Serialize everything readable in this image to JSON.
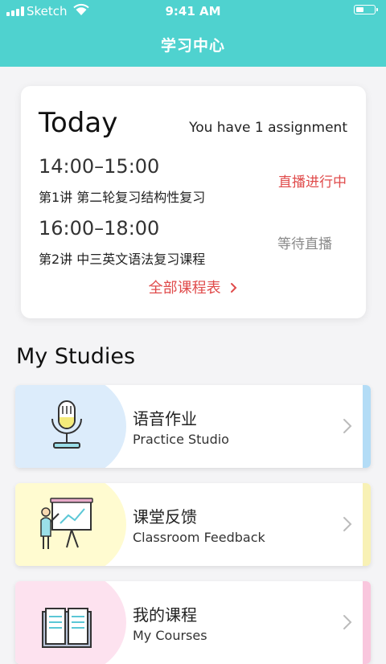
{
  "status_bar": {
    "carrier": "Sketch",
    "time": "9:41 AM",
    "battery_level": 0.45
  },
  "header": {
    "title": "学习中心"
  },
  "today": {
    "title": "Today",
    "assignment_text": "You have 1 assignment",
    "sessions": [
      {
        "time": "14:00–15:00",
        "title": "第1讲 第二轮复习结构性复习",
        "status": "直播进行中",
        "status_color": "#e04b4b"
      },
      {
        "time": "16:00–18:00",
        "title": "第2讲 中三英文语法复习课程",
        "status": "等待直播",
        "status_color": "#8a8a8a"
      }
    ],
    "schedule_link": "全部课程表"
  },
  "studies": {
    "title": "My Studies",
    "items": [
      {
        "cn": "语音作业",
        "en": "Practice Studio",
        "bg_color": "#dcecfb",
        "accent_color": "#b3dcf6",
        "icon": "microphone-icon"
      },
      {
        "cn": "课堂反馈",
        "en": "Classroom Feedback",
        "bg_color": "#fffbd0",
        "accent_color": "#f8f1b5",
        "icon": "presentation-board-icon"
      },
      {
        "cn": "我的课程",
        "en": "My Courses",
        "bg_color": "#fde2ef",
        "accent_color": "#f9c6dd",
        "icon": "open-book-icon"
      }
    ]
  },
  "colors": {
    "header_bg": "#4fd2cf",
    "live": "#e04b4b",
    "waiting": "#8a8a8a"
  }
}
